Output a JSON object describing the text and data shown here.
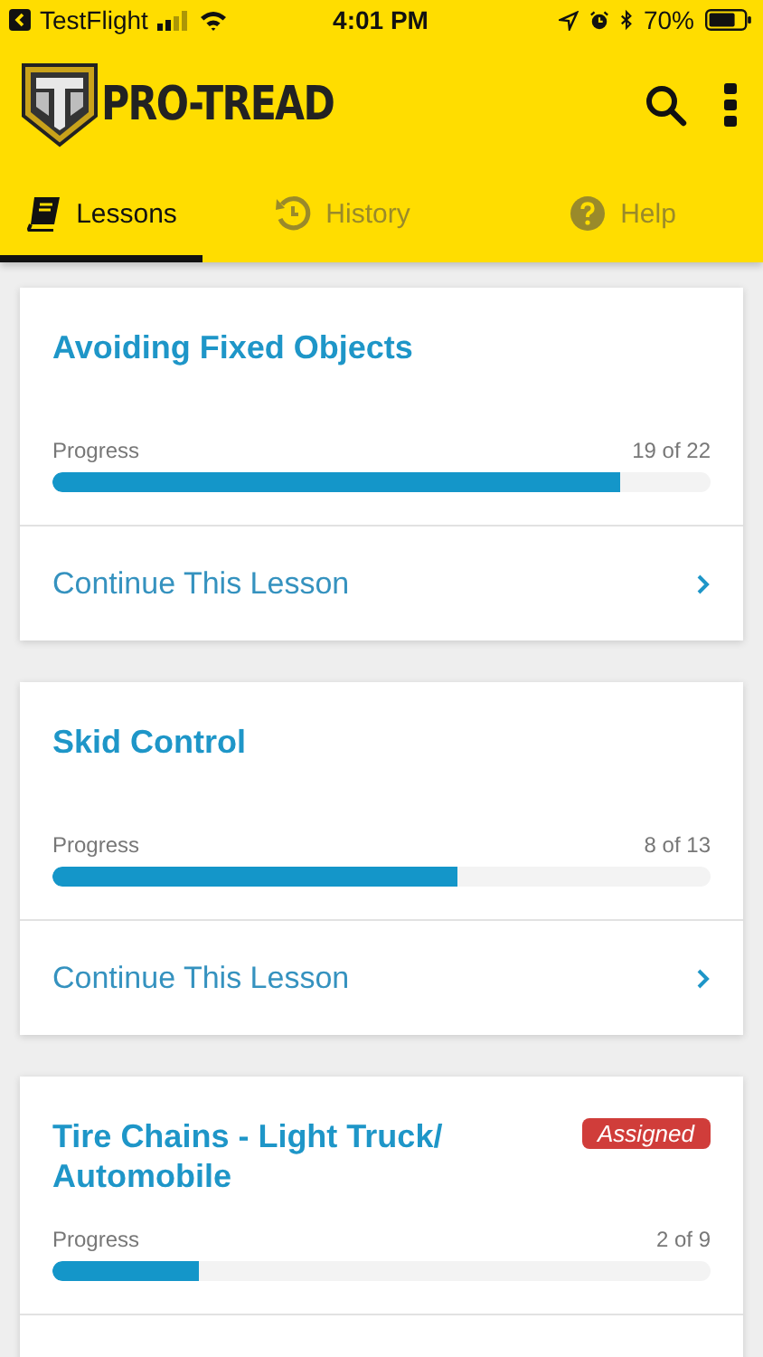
{
  "status_bar": {
    "back_app": "TestFlight",
    "time": "4:01 PM",
    "battery": "70%"
  },
  "app_bar": {
    "logo": "PRO-TREAD"
  },
  "tabs": [
    {
      "label": "Lessons",
      "selected": true
    },
    {
      "label": "History",
      "selected": false
    },
    {
      "label": "Help",
      "selected": false
    }
  ],
  "lessons": [
    {
      "title": "Avoiding Fixed Objects",
      "progress_label": "Progress",
      "count": "19 of 22",
      "level": 0.864,
      "action": "Continue This Lesson"
    },
    {
      "title": "Skid Control",
      "progress_label": "Progress",
      "count": "8 of 13",
      "level": 0.615,
      "action": "Continue This Lesson"
    },
    {
      "title": "Tire Chains - Light Truck/ Automobile",
      "badge": "Assigned",
      "progress_label": "Progress",
      "count": "2 of 9",
      "level": 0.222
    }
  ]
}
